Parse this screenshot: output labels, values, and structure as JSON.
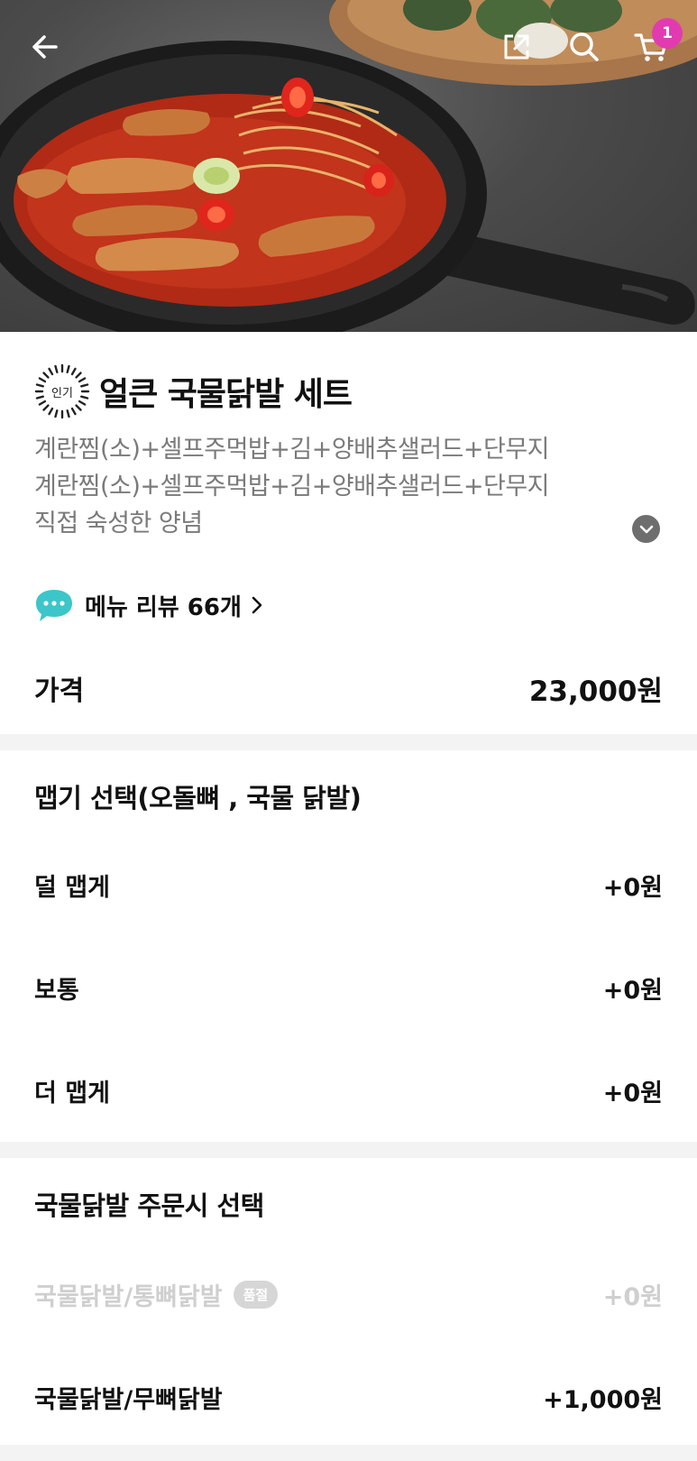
{
  "header": {
    "back_icon": "arrow-left-icon",
    "share_icon": "share-icon",
    "search_icon": "search-icon",
    "cart_icon": "cart-icon",
    "cart_count": "1",
    "badge_color": "#e23bb0"
  },
  "product": {
    "badge": "인기",
    "title": "얼큰 국물닭발 세트",
    "description_lines": [
      "계란찜(소)+셀프주먹밥+김+양배추샐러드+단무지",
      "계란찜(소)+셀프주먹밥+김+양배추샐러드+단무지",
      "직접 숙성한 양념"
    ],
    "review_text": "메뉴 리뷰 66개",
    "price_label": "가격",
    "price_value": "23,000원"
  },
  "option_groups": [
    {
      "title": "맵기 선택(오돌뼈 , 국물 닭발)",
      "options": [
        {
          "name": "덜 맵게",
          "price": "+0원"
        },
        {
          "name": "보통",
          "price": "+0원"
        },
        {
          "name": "더 맵게",
          "price": "+0원"
        }
      ]
    },
    {
      "title": "국물닭발 주문시 선택",
      "options": [
        {
          "name": "국물닭발/통뼈닭발",
          "badge": "품절",
          "price": "+0원"
        },
        {
          "name": "국물닭발/무뼈닭발",
          "price": "+1,000원"
        }
      ]
    }
  ]
}
